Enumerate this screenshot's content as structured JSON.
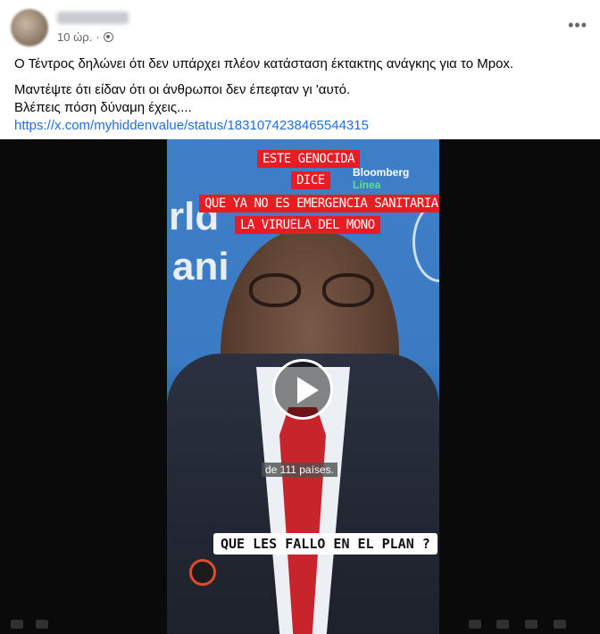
{
  "post": {
    "time": "10 ώρ.",
    "more_label": "•••",
    "text_line1": "Ο Τέντρος δηλώνει ότι δεν υπάρχει πλέον κατάσταση έκτακτης ανάγκης για το Mpox.",
    "text_line2": "Μαντέψτε ότι είδαν ότι οι άνθρωποι δεν έπεφταν γι 'αυτό.",
    "text_line3": "Βλέπεις πόση δύναμη έχεις....",
    "link": "https://x.com/myhiddenvalue/status/1831074238465544315"
  },
  "video": {
    "bg_text_1": "rld",
    "bg_text_2": "ani",
    "watermark_a": "Bloomberg",
    "watermark_b": "Línea",
    "captions": [
      "ESTE GENOCIDA",
      "DICE",
      "QUE YA NO ES EMERGENCIA SANITARIA",
      "LA VIRUELA DEL MONO"
    ],
    "subtitle_small": "de 111 países.",
    "subtitle_big": "QUE LES FALLO EN EL PLAN ?"
  },
  "icons": {
    "globe": "globe-icon",
    "play": "play-icon",
    "more": "more-horizontal-icon"
  },
  "colors": {
    "link": "#216fdb",
    "caption_bg": "#e81c23",
    "meta": "#65676b"
  }
}
